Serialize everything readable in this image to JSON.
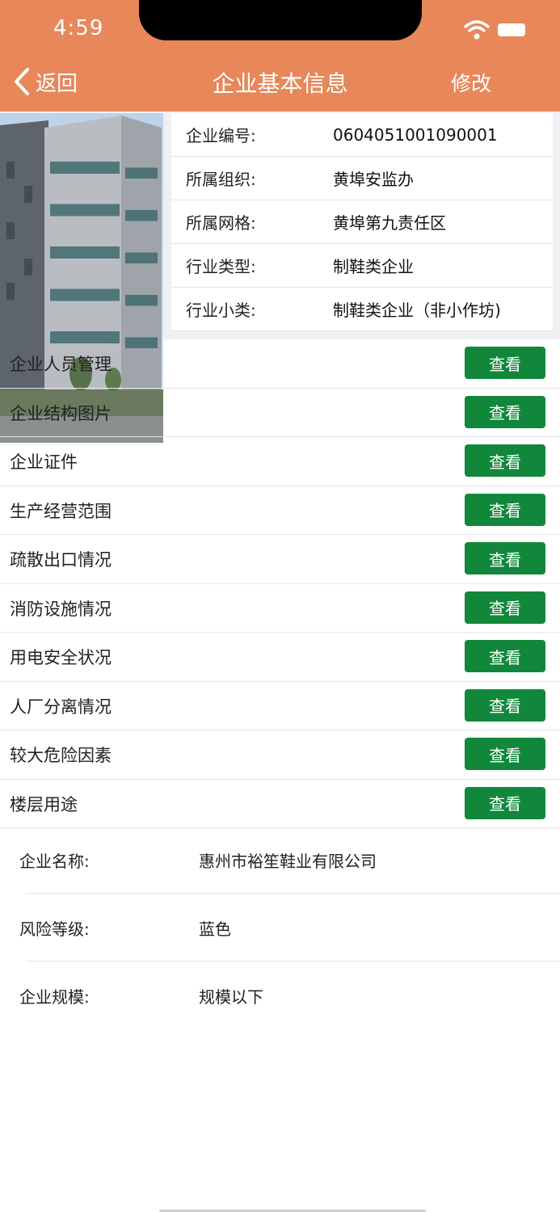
{
  "status_bar": {
    "time": "4:59"
  },
  "nav": {
    "back_label": "返回",
    "title": "企业基本信息",
    "edit_label": "修改"
  },
  "colors": {
    "header_bg": "#E8875A",
    "button_green": "#11873B",
    "panel_bg": "#EFEFF4"
  },
  "info": [
    {
      "label": "企业编号:",
      "value": "0604051001090001"
    },
    {
      "label": "所属组织:",
      "value": "黄埠安监办"
    },
    {
      "label": "所属网格:",
      "value": "黄埠第九责任区"
    },
    {
      "label": "行业类型:",
      "value": "制鞋类企业"
    },
    {
      "label": "行业小类:",
      "value": "制鞋类企业（非小作坊)"
    }
  ],
  "sections": [
    {
      "label": "企业人员管理",
      "button": "查看"
    },
    {
      "label": "企业结构图片",
      "button": "查看"
    },
    {
      "label": "企业证件",
      "button": "查看"
    },
    {
      "label": "生产经营范围",
      "button": "查看"
    },
    {
      "label": "疏散出口情况",
      "button": "查看"
    },
    {
      "label": "消防设施情况",
      "button": "查看"
    },
    {
      "label": "用电安全状况",
      "button": "查看"
    },
    {
      "label": "人厂分离情况",
      "button": "查看"
    },
    {
      "label": "较大危险因素",
      "button": "查看"
    },
    {
      "label": "楼层用途",
      "button": "查看"
    }
  ],
  "details": [
    {
      "label": "企业名称:",
      "value": "惠州市裕笙鞋业有限公司"
    },
    {
      "label": "风险等级:",
      "value": "蓝色"
    },
    {
      "label": "企业规模:",
      "value": "规模以下"
    }
  ],
  "icons": {
    "back": "chevron-left-icon",
    "wifi": "wifi-icon",
    "battery": "battery-icon",
    "photo": "building-photo"
  }
}
